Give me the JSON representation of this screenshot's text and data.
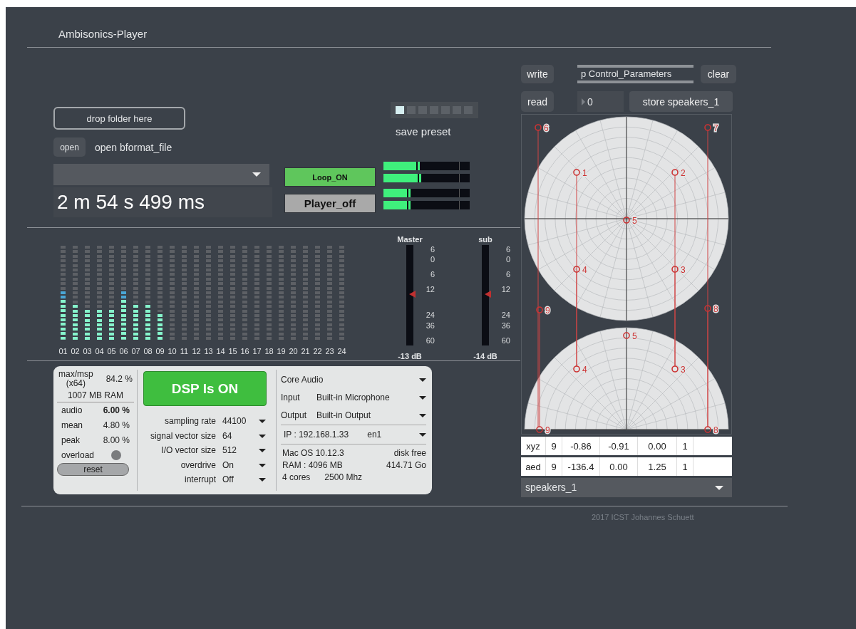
{
  "title": "Ambisonics-Player",
  "file": {
    "drop_zone": "drop folder here",
    "open_button": "open",
    "open_label": "open bformat_file",
    "duration": "2 m 54 s 499 ms"
  },
  "transport": [
    {
      "label": "Loop_ON",
      "on": true
    },
    {
      "label": "Player_off",
      "on": false
    }
  ],
  "output_meters": [
    {
      "level": 0.43
    },
    {
      "level": 0.45
    },
    {
      "level": 0.31
    },
    {
      "level": 0.31
    }
  ],
  "presets": {
    "slots": [
      {
        "selected": true
      },
      {
        "selected": false
      },
      {
        "selected": false
      },
      {
        "selected": false
      },
      {
        "selected": false
      },
      {
        "selected": false
      },
      {
        "selected": false
      }
    ],
    "label": "save preset"
  },
  "channels": [
    {
      "label": "01",
      "level": 0.52
    },
    {
      "label": "02",
      "level": 0.38
    },
    {
      "label": "03",
      "level": 0.33
    },
    {
      "label": "04",
      "level": 0.33
    },
    {
      "label": "05",
      "level": 0.33
    },
    {
      "label": "06",
      "level": 0.52
    },
    {
      "label": "07",
      "level": 0.38
    },
    {
      "label": "08",
      "level": 0.38
    },
    {
      "label": "09",
      "level": 0.29
    },
    {
      "label": "10",
      "level": 0
    },
    {
      "label": "11",
      "level": 0
    },
    {
      "label": "12",
      "level": 0
    },
    {
      "label": "13",
      "level": 0
    },
    {
      "label": "14",
      "level": 0
    },
    {
      "label": "15",
      "level": 0
    },
    {
      "label": "16",
      "level": 0
    },
    {
      "label": "17",
      "level": 0
    },
    {
      "label": "18",
      "level": 0
    },
    {
      "label": "19",
      "level": 0
    },
    {
      "label": "20",
      "level": 0
    },
    {
      "label": "21",
      "level": 0
    },
    {
      "label": "22",
      "level": 0
    },
    {
      "label": "23",
      "level": 0
    },
    {
      "label": "24",
      "level": 0
    }
  ],
  "gains": [
    {
      "label": "Master",
      "level": 0.51,
      "reading": "-13 dB",
      "scale": [
        "6",
        "0",
        "6",
        "12",
        "24",
        "36",
        "60"
      ]
    },
    {
      "label": "sub",
      "level": 0.51,
      "reading": "-14 dB",
      "scale": [
        "6",
        "0",
        "6",
        "12",
        "24",
        "36",
        "60"
      ]
    }
  ],
  "dsp": {
    "app_name": "max/msp",
    "arch": "(x64)",
    "cpu": "84.2 %",
    "memory": "1007 MB RAM",
    "stats": [
      {
        "label": "audio",
        "value": "6.00 %",
        "emphasis": true
      },
      {
        "label": "mean",
        "value": "4.80 %",
        "emphasis": false
      },
      {
        "label": "peak",
        "value": "8.00 %",
        "emphasis": false
      }
    ],
    "overload": {
      "label": "overload",
      "on": false
    },
    "reset": "reset",
    "dsp_button": {
      "label": "DSP Is ON",
      "on": true
    },
    "settings": [
      {
        "label": "sampling rate",
        "value": "44100"
      },
      {
        "label": "signal vector size",
        "value": "64"
      },
      {
        "label": "I/O vector size",
        "value": "512"
      },
      {
        "label": "overdrive",
        "value": "On"
      },
      {
        "label": "interrupt",
        "value": "Off"
      }
    ],
    "driver": "Core Audio",
    "input": {
      "label": "Input",
      "value": "Built-in Microphone"
    },
    "output": {
      "label": "Output",
      "value": "Built-in Output"
    },
    "ip": "IP : 192.168.1.33",
    "interface": "en1",
    "system": {
      "os": "Mac OS 10.12.3",
      "ram": "RAM : 4096 MB",
      "cores": "4 cores",
      "clock": "2500 Mhz",
      "disk_label": "disk free",
      "disk": "414.71 Go"
    }
  },
  "speaker_panel": {
    "write": "write",
    "read": "read",
    "clear": "clear",
    "subpatch": "p Control_Parameters",
    "number": "0",
    "store": "store speakers_1",
    "speakers": [
      {
        "label": "1"
      },
      {
        "label": "2"
      },
      {
        "label": "3"
      },
      {
        "label": "4"
      },
      {
        "label": "5"
      },
      {
        "label": "6"
      },
      {
        "label": "7"
      },
      {
        "label": "8"
      },
      {
        "label": "9"
      }
    ],
    "side_labels": [
      "4",
      "3",
      "5",
      "9",
      "8"
    ],
    "table": [
      [
        "xyz",
        "9",
        "-0.86",
        "-0.91",
        "0.00",
        "1"
      ],
      [
        "aed",
        "9",
        "-136.4",
        "0.00",
        "1.25",
        "1"
      ]
    ],
    "menu": "speakers_1"
  },
  "credit": "2017 ICST  Johannes Schuett"
}
